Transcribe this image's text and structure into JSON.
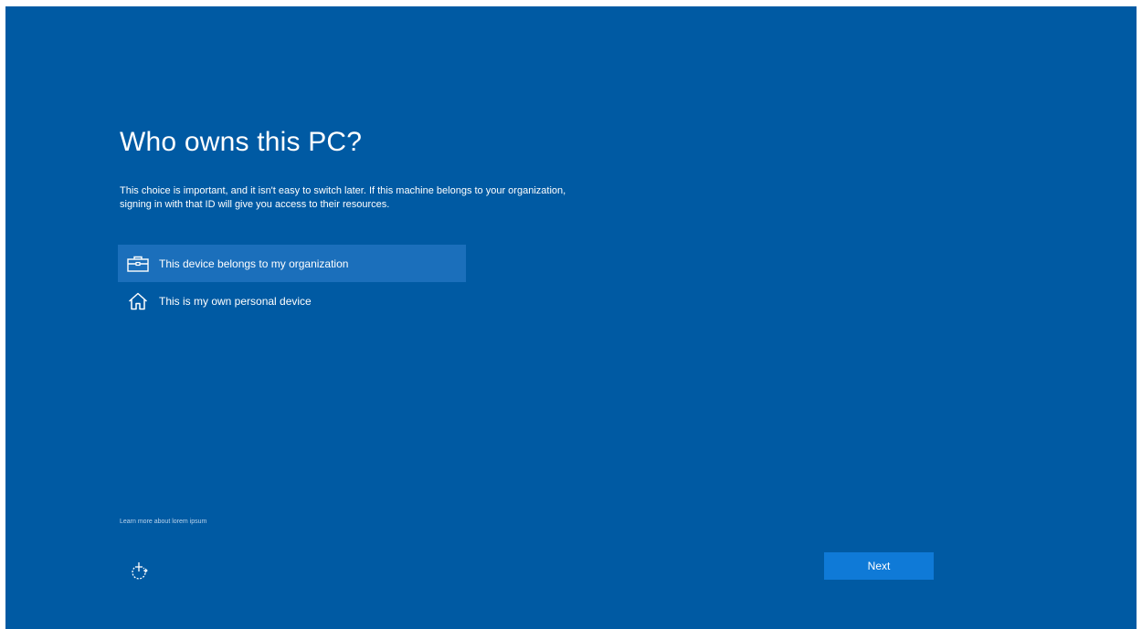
{
  "page": {
    "title": "Who owns this PC?",
    "description_line1": "This choice is important, and it isn't easy to switch later. If this machine belongs to your organization,",
    "description_line2": "signing in with that ID will give you access to their resources."
  },
  "options": [
    {
      "label": "This device belongs to my organization",
      "icon": "briefcase-icon",
      "selected": true
    },
    {
      "label": "This is my own personal device",
      "icon": "home-icon",
      "selected": false
    }
  ],
  "footer": {
    "learn_more": "Learn more about lorem ipsum",
    "accessibility_icon": "ease-of-access-icon",
    "next_label": "Next"
  },
  "colors": {
    "background": "#005aa3",
    "selected_option": "#1b6fbb",
    "button": "#0f7ad7",
    "text": "#ffffff"
  }
}
